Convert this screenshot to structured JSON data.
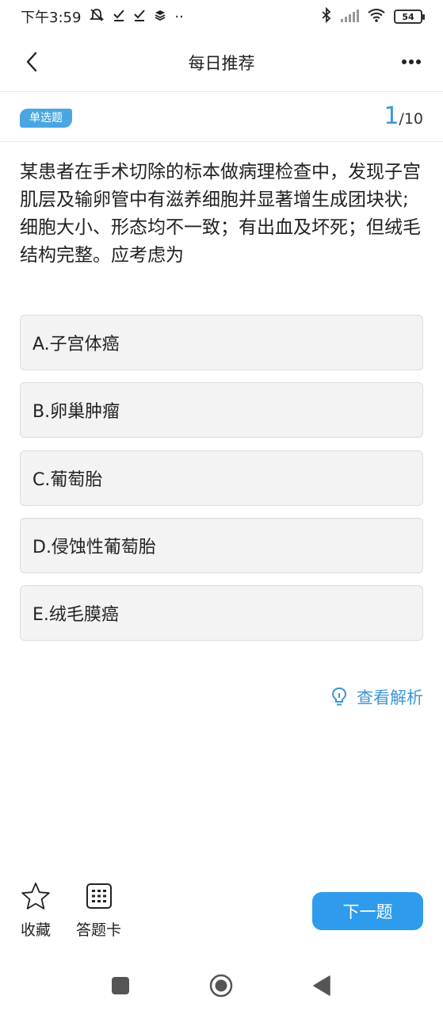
{
  "status_bar": {
    "time": "下午3:59",
    "notification_icons": [
      "mute-icon",
      "check-icon",
      "check-icon",
      "layers-icon"
    ],
    "dots": "··",
    "battery": "54"
  },
  "nav": {
    "title": "每日推荐"
  },
  "question_header": {
    "type_label": "单选题",
    "current": "1",
    "total": "/10"
  },
  "question": {
    "text": "某患者在手术切除的标本做病理检查中，发现子宫肌层及输卵管中有滋养细胞并显著增生成团块状;细胞大小、形态均不一致；有出血及坏死；但绒毛结构完整。应考虑为"
  },
  "options": [
    {
      "label": "A.子宫体癌"
    },
    {
      "label": "B.卵巢肿瘤"
    },
    {
      "label": "C.葡萄胎"
    },
    {
      "label": "D.侵蚀性葡萄胎"
    },
    {
      "label": "E.绒毛膜癌"
    }
  ],
  "analysis": {
    "label": "查看解析"
  },
  "bottom": {
    "favorite_label": "收藏",
    "answer_card_label": "答题卡",
    "next_label": "下一题"
  },
  "colors": {
    "accent": "#2e9bec",
    "accent_text": "#3c96d6",
    "option_bg": "#f3f3f3"
  }
}
